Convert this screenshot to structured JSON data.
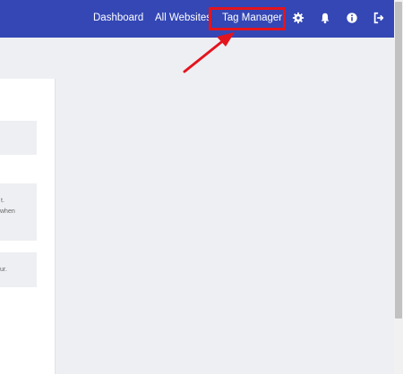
{
  "navbar": {
    "links": [
      "Dashboard",
      "All Websites",
      "Tag Manager"
    ],
    "icons": [
      "gear-icon",
      "bell-icon",
      "info-icon",
      "sign-out-icon"
    ],
    "bg_color": "#3447b5",
    "highlight_color": "#e4141d"
  },
  "panel": {
    "fragments": [
      "t.",
      "when",
      "ur."
    ]
  }
}
